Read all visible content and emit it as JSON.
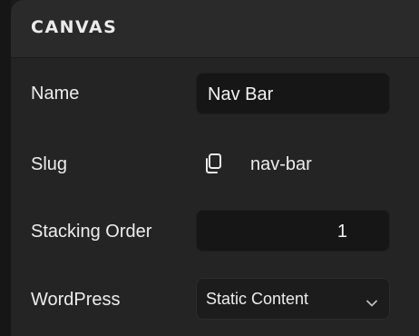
{
  "panel": {
    "title": "CANVAS"
  },
  "fields": {
    "name": {
      "label": "Name",
      "value": "Nav Bar"
    },
    "slug": {
      "label": "Slug",
      "value": "nav-bar",
      "icon": "copy-icon"
    },
    "stacking_order": {
      "label": "Stacking Order",
      "value": "1"
    },
    "wordpress": {
      "label": "WordPress",
      "value": "Static Content",
      "icon": "chevron-down-icon"
    }
  },
  "colors": {
    "panel_bg": "#242424",
    "header_bg": "#2a2a2a",
    "field_bg": "#161616",
    "text": "#ededed"
  }
}
